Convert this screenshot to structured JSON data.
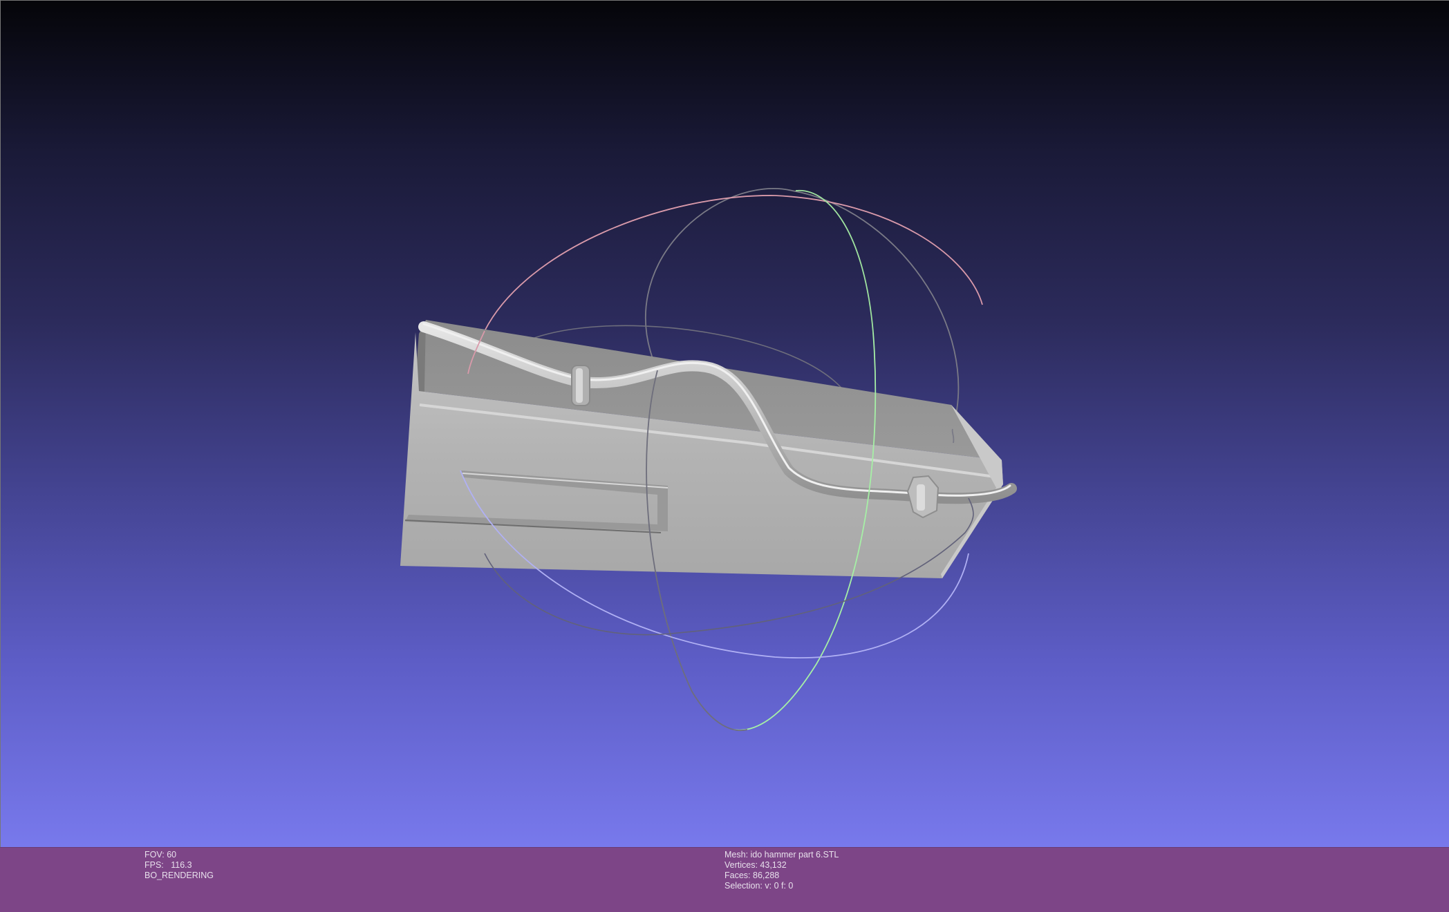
{
  "viewer": {
    "background_top": "#050509",
    "background_bottom": "#7879ec",
    "info_bar_color": "#7d4587",
    "trackball_colors": {
      "x_ring": "#e8a0b4",
      "y_ring": "#a6f0a6",
      "z_ring": "#b0b0f4",
      "gray_ring": "#8a8a96"
    },
    "mesh_color": "#b8b8b8"
  },
  "info": {
    "fov_label": "FOV:",
    "fov_value": "60",
    "fps_label": "FPS:",
    "fps_value": "116.3",
    "render_mode": "BO_RENDERING",
    "mesh_label": "Mesh:",
    "mesh_name": "ido hammer part 6.STL",
    "vertices_label": "Vertices:",
    "vertices_value": "43,132",
    "faces_label": "Faces:",
    "faces_value": "86,288",
    "selection_label": "Selection:",
    "selection_value": "v: 0 f: 0"
  }
}
